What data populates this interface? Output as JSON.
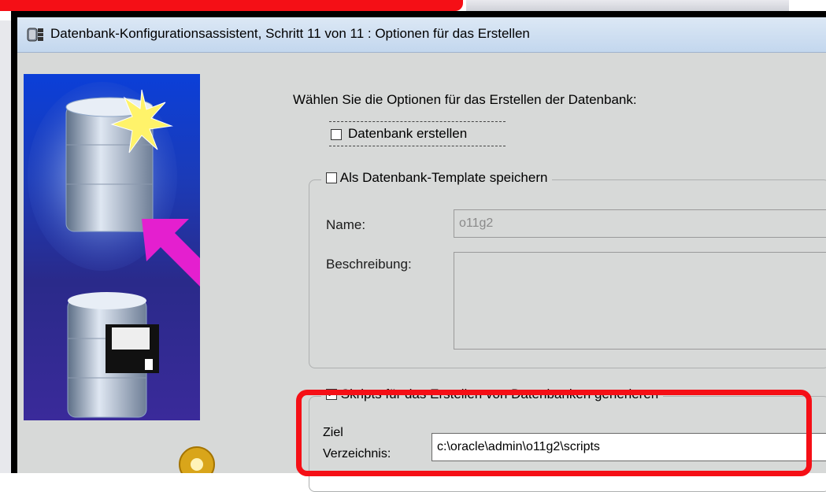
{
  "window": {
    "title": "Datenbank-Konfigurationsassistent, Schritt 11 von 11 : Optionen für das Erstellen"
  },
  "main": {
    "instruction": "Wählen Sie die Optionen für das Erstellen der Datenbank:",
    "create_db": {
      "label": "Datenbank erstellen",
      "checked": false
    },
    "save_template": {
      "label": "Als Datenbank-Template speichern",
      "checked": false,
      "name_label": "Name:",
      "name_value": "o11g2",
      "description_label": "Beschreibung:",
      "description_value": ""
    },
    "generate_scripts": {
      "label": "Skripts für das Erstellen von Datenbanken generieren",
      "checked": true,
      "target_label_line1": "Ziel",
      "target_label_line2": "Verzeichnis:",
      "target_value": "c:\\oracle\\admin\\o11g2\\scripts"
    }
  },
  "colors": {
    "highlight": "#f50f16",
    "window_bg": "#d7d9d8",
    "title_bg": "#c3d7ee"
  }
}
